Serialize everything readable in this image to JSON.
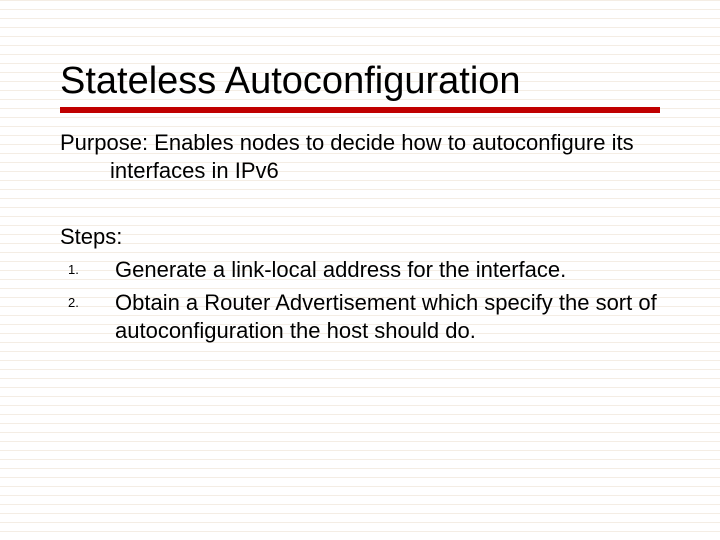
{
  "title": "Stateless Autoconfiguration",
  "purpose_line": "Purpose: Enables nodes to decide how to autoconfigure its interfaces in IPv6",
  "steps_label": "Steps:",
  "steps": [
    {
      "num": "1.",
      "text": "Generate a link-local address for the interface."
    },
    {
      "num": "2.",
      "text": "Obtain a Router Advertisement which specify the sort of autoconfiguration the host should do."
    }
  ]
}
